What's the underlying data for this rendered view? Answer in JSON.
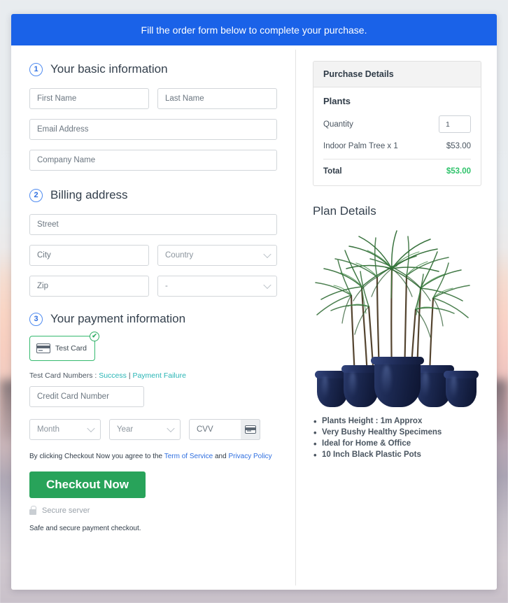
{
  "banner": {
    "text": "Fill the order form below to complete your purchase."
  },
  "sections": {
    "basic": {
      "number": "1",
      "title": "Your basic information",
      "fields": {
        "first_name": "First Name",
        "last_name": "Last Name",
        "email": "Email Address",
        "company": "Company Name"
      }
    },
    "billing": {
      "number": "2",
      "title": "Billing address",
      "fields": {
        "street": "Street",
        "city": "City",
        "country": "Country",
        "zip": "Zip",
        "state": "-"
      }
    },
    "payment": {
      "number": "3",
      "title": "Your payment information",
      "method_label": "Test Card",
      "method_selected_badge": "✔",
      "test_numbers_label": "Test Card Numbers :",
      "test_success_link": "Success",
      "test_separator": "|",
      "test_failure_link": "Payment Failure",
      "fields": {
        "card_number": "Credit Card Number",
        "month": "Month",
        "year": "Year",
        "cvv": "CVV"
      },
      "terms_prefix": "By clicking Checkout Now you agree to the",
      "terms_link_1": "Term of Service",
      "terms_and": "and",
      "terms_link_2": "Privacy Policy",
      "checkout_button": "Checkout Now",
      "secure_server": "Secure server",
      "safe_note": "Safe and secure payment checkout."
    }
  },
  "purchase": {
    "header": "Purchase Details",
    "category": "Plants",
    "quantity_label": "Quantity",
    "quantity_value": "1",
    "item_label": "Indoor Palm Tree x 1",
    "item_price": "$53.00",
    "total_label": "Total",
    "total_value": "$53.00"
  },
  "plan": {
    "title": "Plan Details",
    "image_alt": "indoor-palm-trees-in-blue-pots",
    "features": [
      "Plants Height : 1m Approx",
      "Very Bushy Healthy Specimens",
      "Ideal for Home & Office",
      "10 Inch Black Plastic Pots"
    ]
  },
  "colors": {
    "banner_blue": "#1a62e8",
    "step_blue": "#2f6fe0",
    "checkout_green": "#28a35a",
    "total_green": "#2fc36b",
    "link_teal": "#28b5b5",
    "card_border_green": "#35b96f"
  }
}
